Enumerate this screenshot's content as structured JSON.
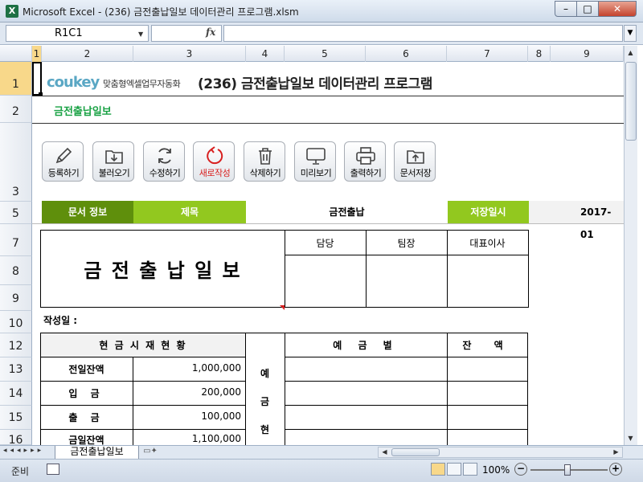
{
  "window": {
    "title": "Microsoft Excel - (236) 금전출납일보 데이터관리 프로그램.xlsm",
    "app_icon": "X",
    "min_glyph": "–",
    "max_glyph": "□",
    "close_glyph": "✕"
  },
  "formula_bar": {
    "name_box": "R1C1",
    "fx": "fx",
    "formula": ""
  },
  "columns": [
    "1",
    "2",
    "3",
    "4",
    "5",
    "6",
    "7",
    "8",
    "9"
  ],
  "rows": [
    "1",
    "2",
    "3",
    "5",
    "7",
    "8",
    "9",
    "10",
    "12",
    "13",
    "14",
    "15",
    "16"
  ],
  "header": {
    "logo": "coukey",
    "logo_sub": "맞춤형엑셀업무자동화",
    "program_title": "(236) 금전출납일보 데이터관리 프로그램",
    "subtitle": "금전출납일보"
  },
  "toolbar": [
    {
      "label": "등록하기",
      "icon": "pencil-icon",
      "color": "#000000"
    },
    {
      "label": "불러오기",
      "icon": "folder-download-icon",
      "color": "#000000"
    },
    {
      "label": "수정하기",
      "icon": "refresh-icon",
      "color": "#000000"
    },
    {
      "label": "새로작성",
      "icon": "new-circle-icon",
      "color": "#d81f1f"
    },
    {
      "label": "삭제하기",
      "icon": "trash-icon",
      "color": "#000000"
    },
    {
      "label": "미리보기",
      "icon": "monitor-icon",
      "color": "#000000"
    },
    {
      "label": "출력하기",
      "icon": "printer-icon",
      "color": "#000000"
    },
    {
      "label": "문서저장",
      "icon": "folder-upload-icon",
      "color": "#000000"
    }
  ],
  "info_row": {
    "doc_info_label": "문서 정보",
    "title_label": "제목",
    "title_value": "금전출납",
    "save_date_label": "저장일시",
    "save_date_value": "2017-01"
  },
  "form": {
    "main_title": "금 전 출 납 일 보",
    "approvals": [
      "담당",
      "팀장",
      "대표이사"
    ],
    "date_label": "작성일 :",
    "cash_header": "현 금 시 재 현 황",
    "deposit_side_label": [
      "예",
      "금",
      "현"
    ],
    "deposit_header": "예 금 별",
    "balance_header": "잔 액",
    "cash_rows": [
      {
        "label": "전일잔액",
        "value": "1,000,000"
      },
      {
        "label": "입 금",
        "value": "200,000"
      },
      {
        "label": "출 금",
        "value": "100,000"
      },
      {
        "label": "금일잔액",
        "value": "1,100,000"
      }
    ]
  },
  "tabs": {
    "active_sheet": "금전출납일보",
    "nav_glyphs": "◂◂◂▸▸▸"
  },
  "status": {
    "ready": "준비",
    "zoom": "100%",
    "zoom_minus": "−",
    "zoom_plus": "+"
  },
  "colors": {
    "green_dark": "#5f8f0c",
    "green_light": "#92c81f",
    "subtitle_green": "#1aa245",
    "logo_blue": "#5aa7c4"
  }
}
